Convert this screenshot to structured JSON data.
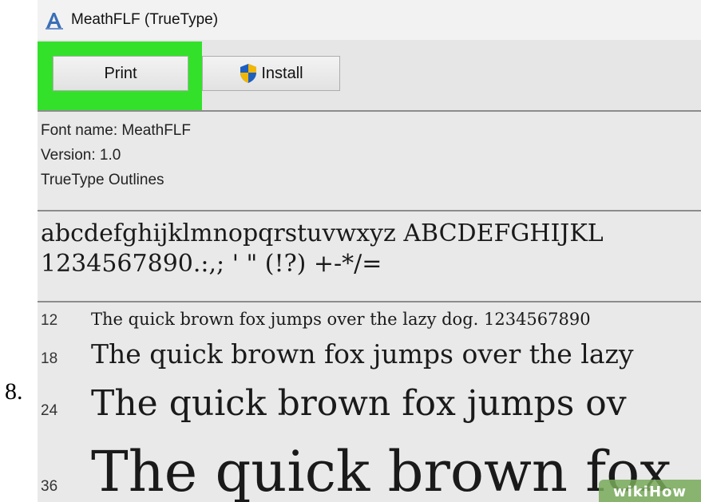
{
  "step": {
    "number": "8."
  },
  "window": {
    "title": "MeathFLF (TrueType)",
    "icon": "font-viewer-icon"
  },
  "toolbar": {
    "print_label": "Print",
    "install_label": "Install",
    "install_icon": "uac-shield-icon",
    "highlight_color": "#33e12a"
  },
  "font_info": {
    "name": "Font name: MeathFLF",
    "version": "Version: 1.0",
    "outlines": "TrueType Outlines"
  },
  "character_set": {
    "line1": "abcdefghijklmnopqrstuvwxyz ABCDEFGHIJKL",
    "line2": "1234567890.:,; ' \" (!?) +-*/="
  },
  "samples": [
    {
      "size": "12",
      "text": "The quick brown fox jumps over the lazy dog. 1234567890"
    },
    {
      "size": "18",
      "text": "The quick brown fox jumps over the lazy"
    },
    {
      "size": "24",
      "text": "The quick brown fox jumps ov"
    },
    {
      "size": "36",
      "text": "The quick brown fox"
    }
  ],
  "watermark": {
    "text": "wikiHow"
  }
}
